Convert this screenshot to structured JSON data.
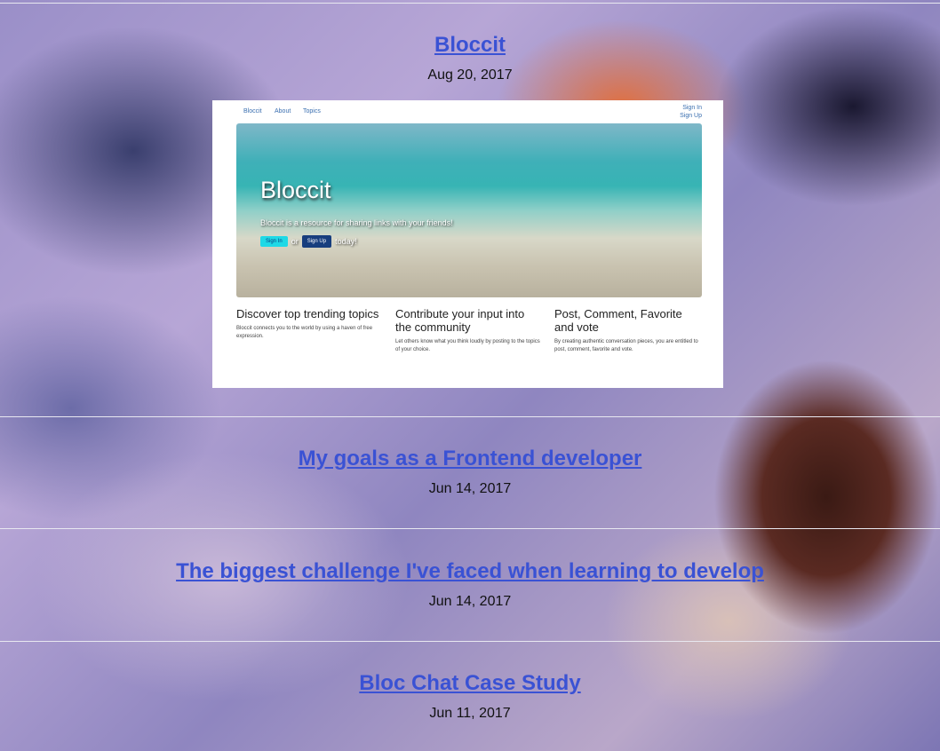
{
  "posts": [
    {
      "title": "Bloccit",
      "date": "Aug 20, 2017"
    },
    {
      "title": "My goals as a Frontend developer",
      "date": "Jun 14, 2017"
    },
    {
      "title": "The biggest challenge I've faced when learning to develop",
      "date": "Jun 14, 2017"
    },
    {
      "title": "Bloc Chat Case Study",
      "date": "Jun 11, 2017"
    }
  ],
  "thumbnail": {
    "nav": [
      "Bloccit",
      "About",
      "Topics"
    ],
    "sign_in": "Sign In",
    "sign_up": "Sign Up",
    "hero_title": "Bloccit",
    "hero_subtitle": "Bloccit is a resource for sharing links with your friends!",
    "hero_sign_in": "Sign In",
    "hero_or": "or",
    "hero_sign_up": "Sign Up",
    "hero_today": "today!",
    "features": [
      {
        "heading": "Discover top trending topics",
        "text": "Bloccit connects you to the world by using a haven of free expression."
      },
      {
        "heading": "Contribute your input into the community",
        "text": "Let others know what you think loudly by posting to the topics of your choice."
      },
      {
        "heading": "Post, Comment, Favorite and vote",
        "text": "By creating authentic conversation pieces, you are entitled to post, comment, favorite and vote."
      }
    ]
  },
  "colors": {
    "link": "#3a52d4",
    "divider": "#e8e8f0"
  }
}
